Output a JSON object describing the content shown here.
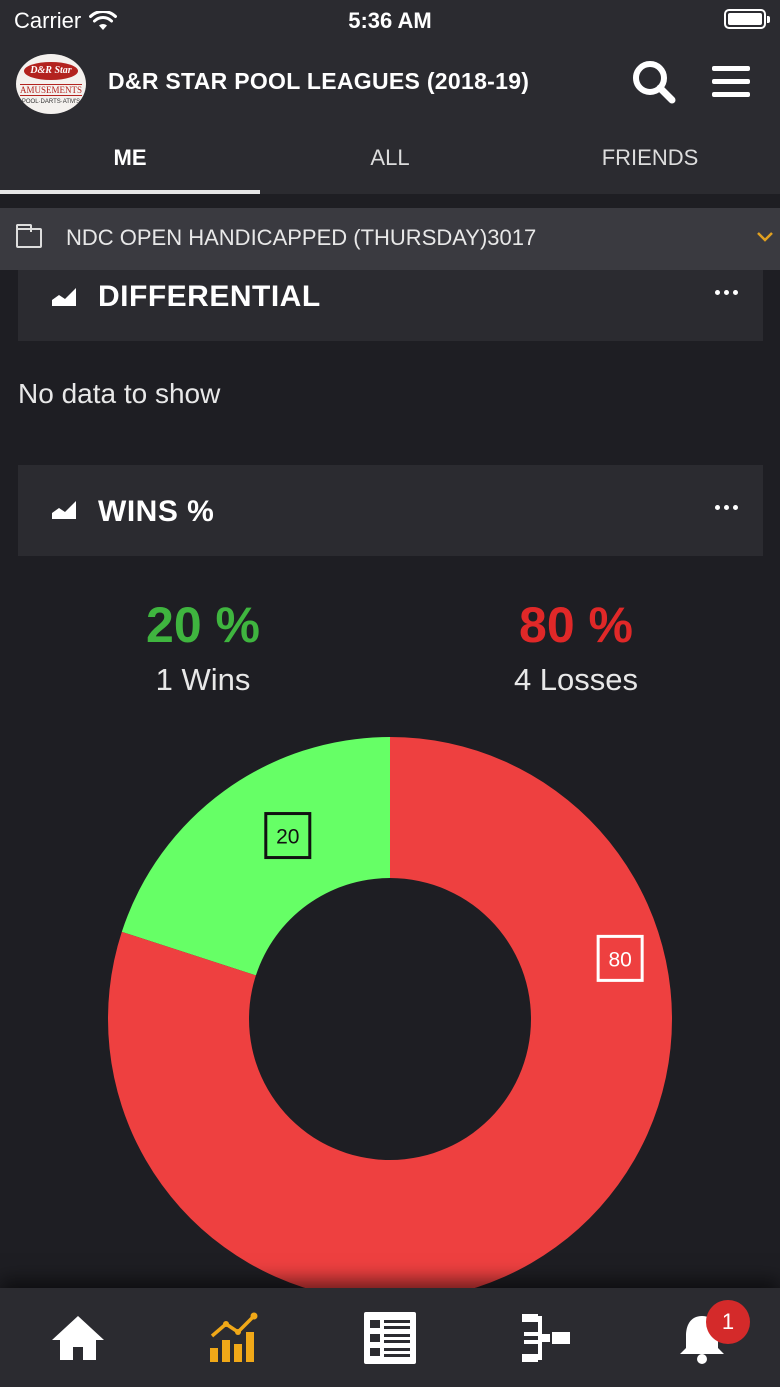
{
  "status_bar": {
    "carrier": "Carrier",
    "time": "5:36 AM"
  },
  "header": {
    "logo": {
      "line1": "D&R Star",
      "line2": "AMUSEMENTS",
      "line3": "POOL·DARTS·ATM'S"
    },
    "title": "D&R STAR POOL LEAGUES (2018-19)",
    "search_icon": "search-icon",
    "menu_icon": "hamburger-menu-icon"
  },
  "tabs": [
    {
      "label": "ME",
      "active": true
    },
    {
      "label": "ALL",
      "active": false
    },
    {
      "label": "FRIENDS",
      "active": false
    }
  ],
  "filter": {
    "icon": "folder-icon",
    "label": "NDC OPEN HANDICAPPED (THURSDAY)3017",
    "chevron_color": "#e0a020"
  },
  "differential": {
    "title": "DIFFERENTIAL",
    "empty_text": "No data to show"
  },
  "wins": {
    "title": "WINS %",
    "wins_pct": "20 %",
    "wins_text": "1 Wins",
    "losses_pct": "80 %",
    "losses_text": "4 Losses",
    "colors": {
      "win_text": "#3fb53f",
      "loss_text": "#e02828"
    }
  },
  "chart_data": {
    "type": "pie",
    "donut": true,
    "categories": [
      "Wins",
      "Losses"
    ],
    "values": [
      20,
      80
    ],
    "labels": [
      "20",
      "80"
    ],
    "colors": [
      "#66ff66",
      "#ee4040"
    ]
  },
  "bottom_nav": {
    "items": [
      {
        "icon": "home-icon",
        "active": false
      },
      {
        "icon": "stats-chart-icon",
        "active": true
      },
      {
        "icon": "standings-list-icon",
        "active": false
      },
      {
        "icon": "bracket-icon",
        "active": false
      },
      {
        "icon": "notifications-bell-icon",
        "active": false
      }
    ],
    "badge_count": "1",
    "active_color": "#f0a818"
  }
}
